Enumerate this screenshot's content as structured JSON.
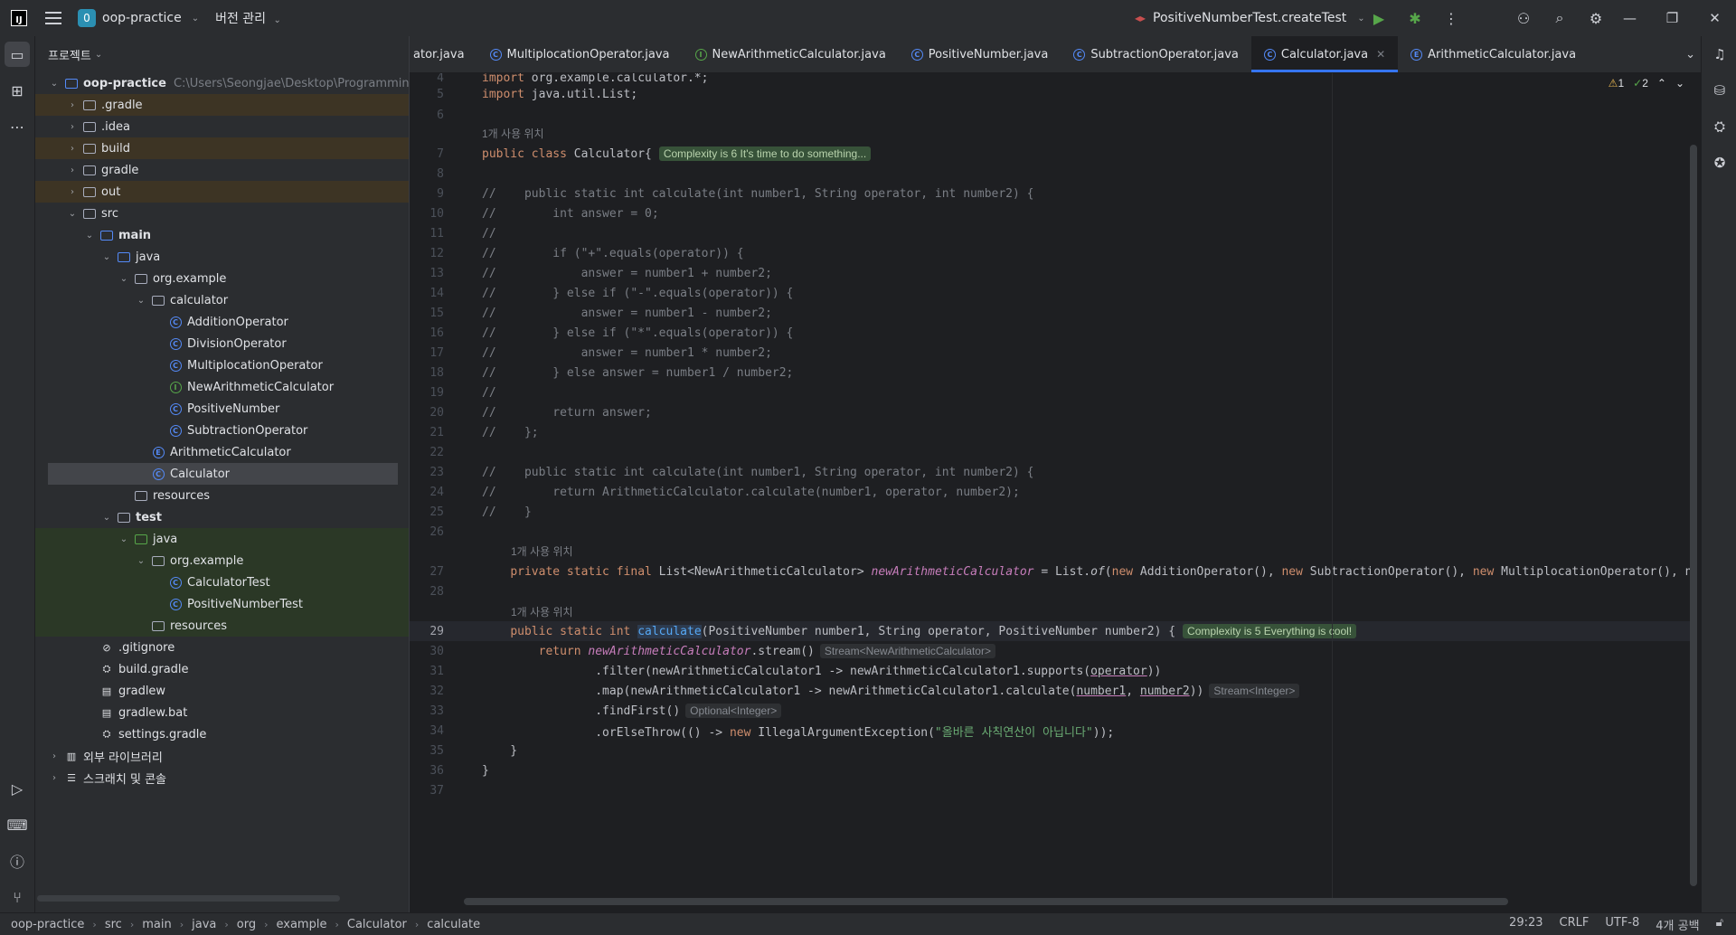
{
  "titlebar": {
    "project_badge": "0",
    "project_name": "oop-practice",
    "vcs_label": "버전 관리",
    "run_config": "PositiveNumberTest.createTest"
  },
  "project_panel": {
    "title": "프로젝트",
    "root_name": "oop-practice",
    "root_path": "C:\\Users\\Seongjae\\Desktop\\Programming\\c",
    "items": [
      {
        "label": ".gradle"
      },
      {
        "label": ".idea"
      },
      {
        "label": "build"
      },
      {
        "label": "gradle"
      },
      {
        "label": "out"
      },
      {
        "label": "src"
      },
      {
        "label": "main"
      },
      {
        "label": "java"
      },
      {
        "label": "org.example"
      },
      {
        "label": "calculator"
      },
      {
        "label": "AdditionOperator"
      },
      {
        "label": "DivisionOperator"
      },
      {
        "label": "MultiplocationOperator"
      },
      {
        "label": "NewArithmeticCalculator"
      },
      {
        "label": "PositiveNumber"
      },
      {
        "label": "SubtractionOperator"
      },
      {
        "label": "ArithmeticCalculator"
      },
      {
        "label": "Calculator"
      },
      {
        "label": "resources"
      },
      {
        "label": "test"
      },
      {
        "label": "java"
      },
      {
        "label": "org.example"
      },
      {
        "label": "CalculatorTest"
      },
      {
        "label": "PositiveNumberTest"
      },
      {
        "label": "resources"
      },
      {
        "label": ".gitignore"
      },
      {
        "label": "build.gradle"
      },
      {
        "label": "gradlew"
      },
      {
        "label": "gradlew.bat"
      },
      {
        "label": "settings.gradle"
      },
      {
        "label": "외부 라이브러리"
      },
      {
        "label": "스크래치 및 콘솔"
      }
    ]
  },
  "tabs": [
    {
      "label": "ator.java"
    },
    {
      "label": "MultiplocationOperator.java"
    },
    {
      "label": "NewArithmeticCalculator.java"
    },
    {
      "label": "PositiveNumber.java"
    },
    {
      "label": "SubtractionOperator.java"
    },
    {
      "label": "Calculator.java"
    },
    {
      "label": "ArithmeticCalculator.java"
    }
  ],
  "editor": {
    "warnings_count": "1",
    "ok_count": "2",
    "usage_hint": "1개 사용 위치",
    "complexity_class": "Complexity is 6 It's time to do something...",
    "complexity_method": "Complexity is 5 Everything is cool!",
    "hint_stream": "Stream<NewArithmeticCalculator>",
    "hint_stream_int": "Stream<Integer>",
    "hint_optional": "Optional<Integer>",
    "error_message": "\"올바른 사칙연산이 아닙니다\""
  },
  "statusbar": {
    "breadcrumb": [
      "oop-practice",
      "src",
      "main",
      "java",
      "org",
      "example",
      "Calculator",
      "calculate"
    ],
    "position": "29:23",
    "line_sep": "CRLF",
    "encoding": "UTF-8",
    "indent": "4개 공백"
  }
}
